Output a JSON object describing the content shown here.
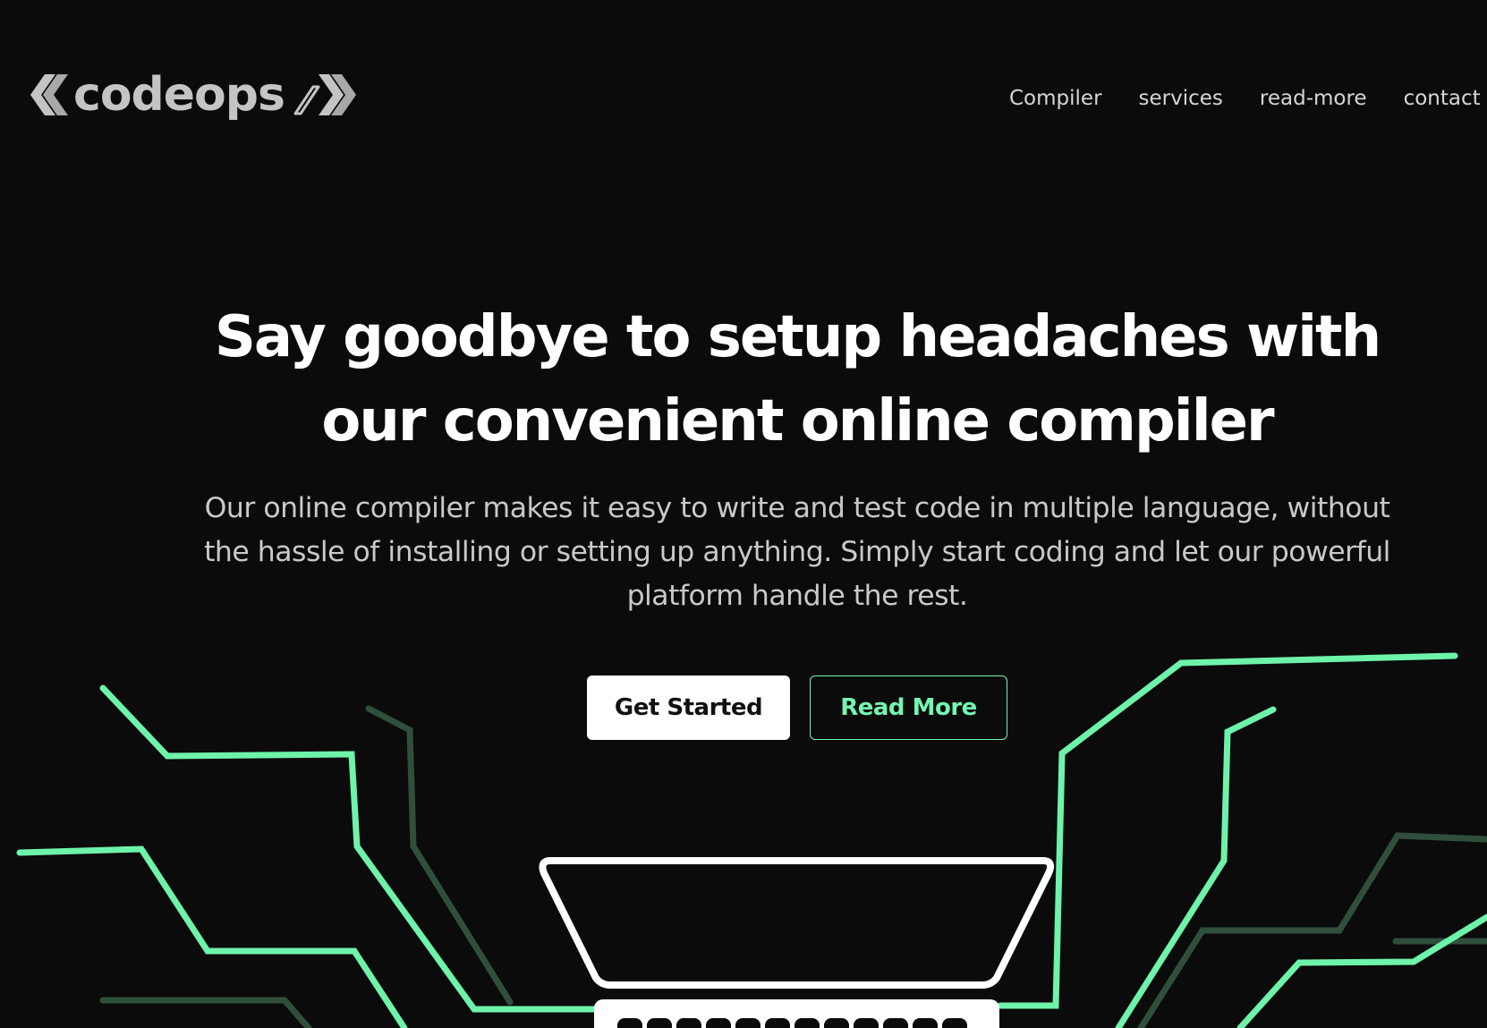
{
  "brand": {
    "name": "codeops",
    "accent_color": "#74f5b0",
    "logo_color": "#c4c4c4"
  },
  "nav": {
    "items": [
      {
        "label": "Compiler"
      },
      {
        "label": "services"
      },
      {
        "label": "read-more"
      },
      {
        "label": "contact"
      }
    ]
  },
  "hero": {
    "title_lines": [
      "Say goodbye to setup headaches with",
      "our convenient online compiler"
    ],
    "subtitle_lines": [
      "Our online compiler makes it easy to write and test code in multiple language, without",
      "the hassle of installing or setting up anything. Simply start coding and let our powerful",
      "platform handle the rest."
    ],
    "primary_button": "Get Started",
    "secondary_button": "Read More"
  },
  "illustration": {
    "icon": "laptop-circuit-illustration",
    "colors": {
      "bright_line": "#6ef3aa",
      "dim_line": "#2f4f3c",
      "laptop": "#ffffff"
    }
  }
}
